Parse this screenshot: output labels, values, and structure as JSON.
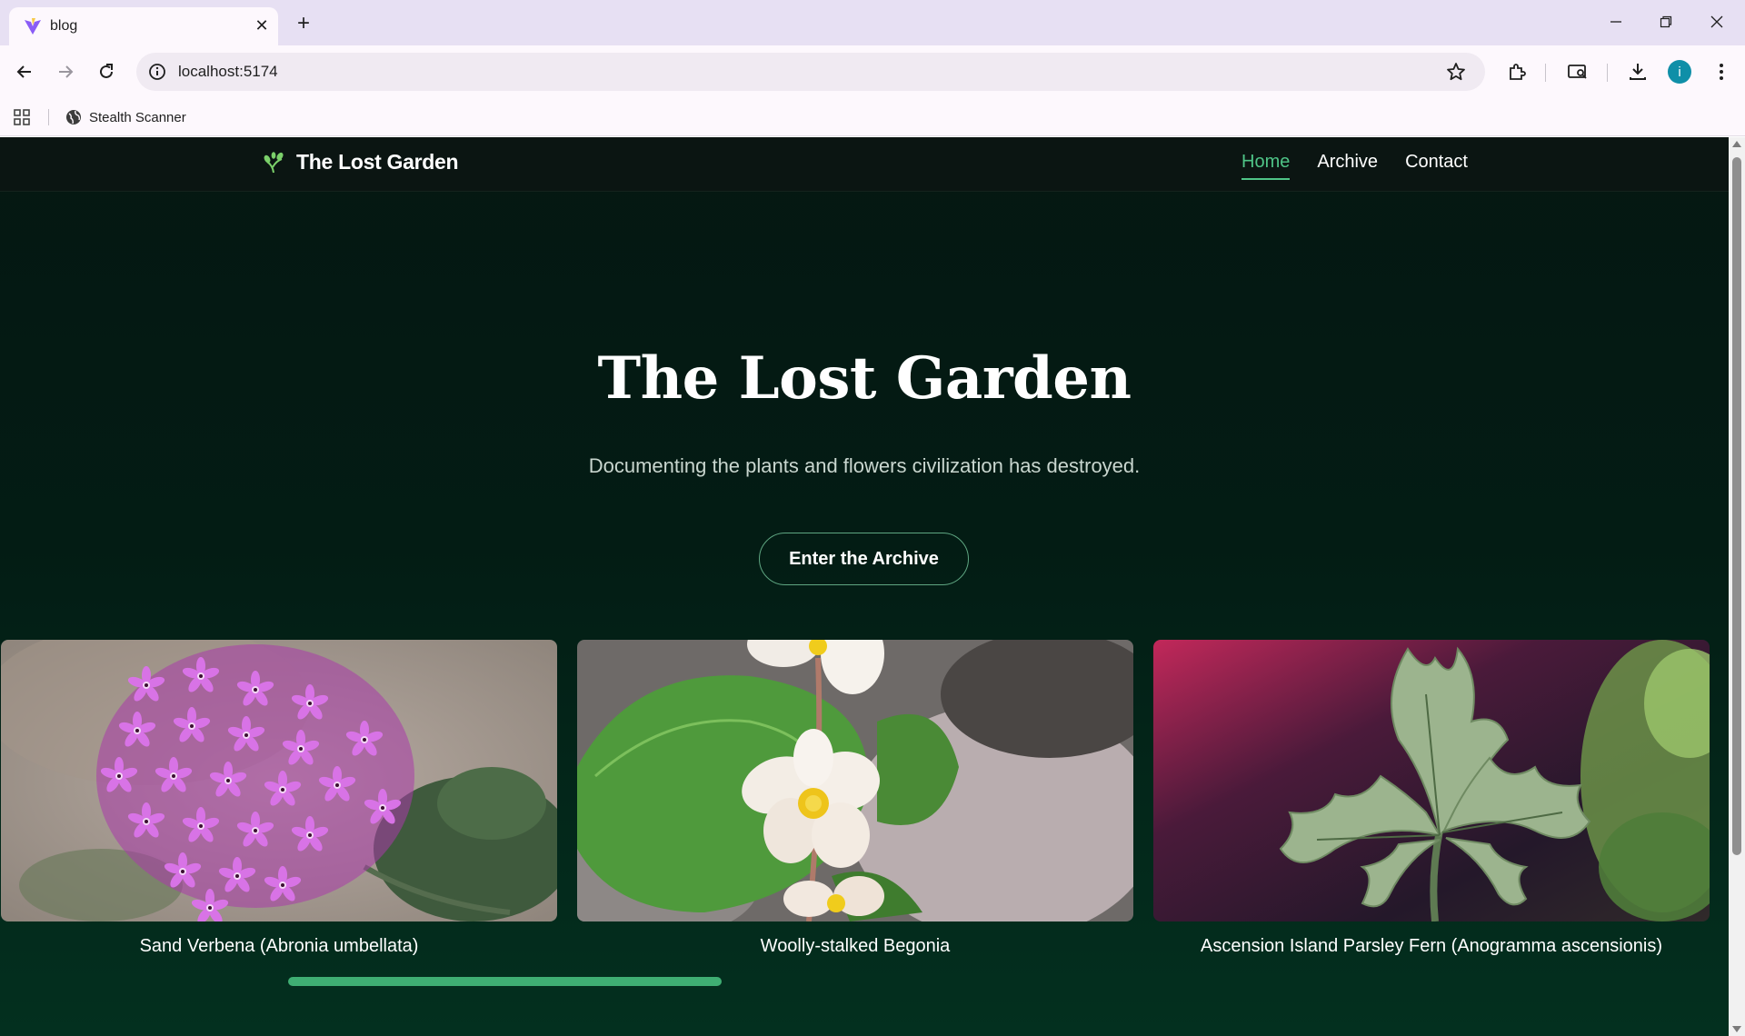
{
  "browser": {
    "tab_title": "blog",
    "url": "localhost:5174",
    "bookmark_label": "Stealth Scanner",
    "avatar_letter": "i",
    "accent": "#0f8fa8"
  },
  "site": {
    "brand": "The Lost Garden",
    "nav": [
      {
        "label": "Home",
        "active": true
      },
      {
        "label": "Archive",
        "active": false
      },
      {
        "label": "Contact",
        "active": false
      }
    ],
    "hero": {
      "title": "The Lost Garden",
      "subtitle": "Documenting the plants and flowers civilization has destroyed.",
      "cta": "Enter the Archive"
    },
    "cards": [
      {
        "caption": "Sand Verbena (Abronia umbellata)",
        "image_icon": "purple-flower-cluster"
      },
      {
        "caption": "Woolly-stalked Begonia",
        "image_icon": "white-begonia-flower"
      },
      {
        "caption": "Ascension Island Parsley Fern (Anogramma ascensionis)",
        "image_icon": "green-fern-frond"
      }
    ],
    "carousel_progress": 0.31,
    "colors": {
      "accent": "#4fc487",
      "background": "#031c14"
    }
  }
}
